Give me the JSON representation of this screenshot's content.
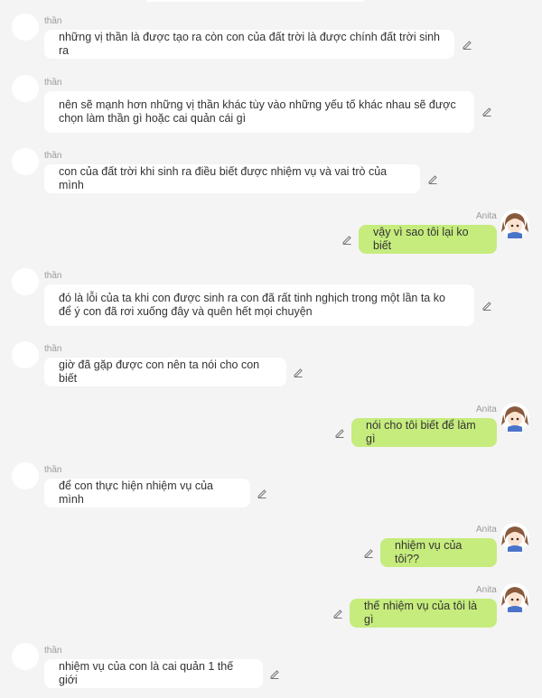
{
  "messages": [
    {
      "sender": "thần",
      "text": "những vị thần là được tạo ra còn con của đất trời là được chính đất trời sinh ra",
      "direction": "in"
    },
    {
      "sender": "thần",
      "text": "nên sẽ mạnh hơn những vị thần khác tùy vào những yếu tố khác nhau sẽ được chọn làm thần gì hoặc cai quản cái gì",
      "direction": "in"
    },
    {
      "sender": "thần",
      "text": "con của đất trời khi sinh ra điều biết được nhiệm vụ và vai trò của mình",
      "direction": "in"
    },
    {
      "sender": "Anita",
      "text": "vậy vì sao tôi lại ko biết",
      "direction": "out"
    },
    {
      "sender": "thần",
      "text": "đó là lỗi của ta khi con được sinh ra con đã rất tinh nghịch trong một lần ta ko để ý con đã rơi xuống đây và quên hết mọi chuyện",
      "direction": "in"
    },
    {
      "sender": "thần",
      "text": "giờ đã gặp được con nên ta nói cho con biết",
      "direction": "in"
    },
    {
      "sender": "Anita",
      "text": "nói cho tôi biết để làm gì",
      "direction": "out"
    },
    {
      "sender": "thần",
      "text": "để con thực hiện nhiệm vụ của mình",
      "direction": "in"
    },
    {
      "sender": "Anita",
      "text": "nhiệm vụ của tôi??",
      "direction": "out"
    },
    {
      "sender": "Anita",
      "text": "thế nhiệm vụ của tôi là gì",
      "direction": "out"
    },
    {
      "sender": "thần",
      "text": "nhiệm vụ của con là cai quản 1 thế giới",
      "direction": "in"
    }
  ],
  "colors": {
    "background": "#f4f4f4",
    "incoming_bubble": "#ffffff",
    "outgoing_bubble": "#c5ec7d",
    "sender_name": "#9a9a9a"
  },
  "icons": {
    "edit": "pencil-edit-icon",
    "incoming_avatar": "blank-avatar",
    "outgoing_avatar": "anime-girl-avatar"
  }
}
